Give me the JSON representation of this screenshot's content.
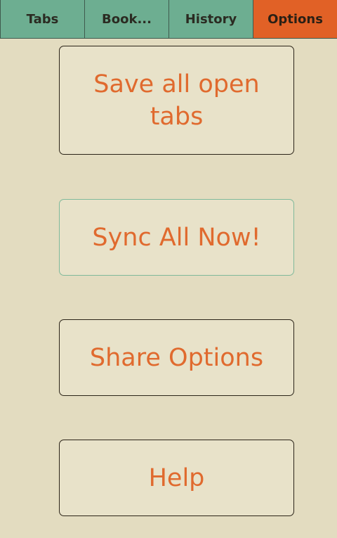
{
  "tabs": [
    {
      "label": "Tabs"
    },
    {
      "label": "Book..."
    },
    {
      "label": "History"
    },
    {
      "label": "Options",
      "active": true
    }
  ],
  "buttons": {
    "save_tabs": "Save all open tabs",
    "sync_now": "Sync All Now!",
    "share_options": "Share Options",
    "help": "Help"
  },
  "colors": {
    "background": "#e3dcc0",
    "tab_green": "#6dae91",
    "tab_active": "#e16126",
    "button_text": "#e06a2e"
  }
}
